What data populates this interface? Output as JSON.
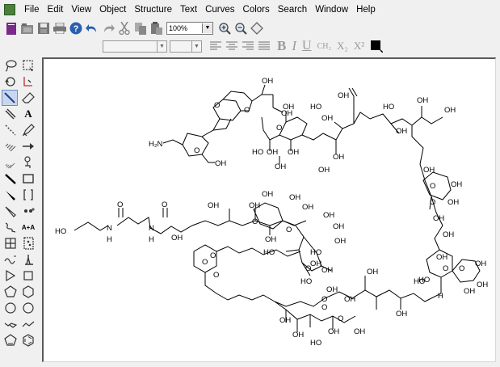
{
  "menubar": {
    "items": [
      {
        "id": "file",
        "label": "File"
      },
      {
        "id": "edit",
        "label": "Edit"
      },
      {
        "id": "view",
        "label": "View"
      },
      {
        "id": "object",
        "label": "Object"
      },
      {
        "id": "structure",
        "label": "Structure"
      },
      {
        "id": "text",
        "label": "Text"
      },
      {
        "id": "curves",
        "label": "Curves"
      },
      {
        "id": "colors",
        "label": "Colors"
      },
      {
        "id": "search",
        "label": "Search"
      },
      {
        "id": "window",
        "label": "Window"
      },
      {
        "id": "help",
        "label": "Help"
      }
    ]
  },
  "toolbar": {
    "zoom_value": "100%",
    "zoom_options": [
      "100%"
    ]
  },
  "format_bar": {
    "bold": "B",
    "italic": "I",
    "underline": "U",
    "ch2": "CH₂",
    "subscript": "X₂",
    "superscript": "X²"
  },
  "palette": {
    "text_tool": "A",
    "charge_tool": "A+A"
  },
  "molecule": {
    "labels": [
      "HO",
      "N",
      "H",
      "O",
      "N",
      "H",
      "O",
      "OH",
      "OH",
      "OH",
      "OH",
      "OH",
      "OH",
      "OH",
      "OH",
      "OH",
      "H₂N",
      "OH",
      "OH",
      "OH",
      "HO",
      "OH",
      "OH",
      "OH",
      "HO",
      "OH",
      "OH",
      "HO",
      "OH",
      "OH",
      "OH",
      "OH",
      "OH",
      "OH",
      "OH",
      "HO",
      "OH",
      "HO",
      "OH",
      "OH",
      "OH",
      "OH",
      "OH",
      "O",
      "O",
      "O",
      "O",
      "O",
      "O",
      "O",
      "O",
      "O",
      "O",
      "O",
      "HO",
      "O",
      "OH",
      "OH",
      "OH",
      "O",
      "HO",
      "H",
      "OH",
      "OH",
      "OH",
      "HO",
      "OH",
      "OH",
      "OH",
      "OH",
      "HO",
      "OH",
      "OH",
      "O",
      "O",
      "O",
      "O",
      "OH"
    ]
  }
}
